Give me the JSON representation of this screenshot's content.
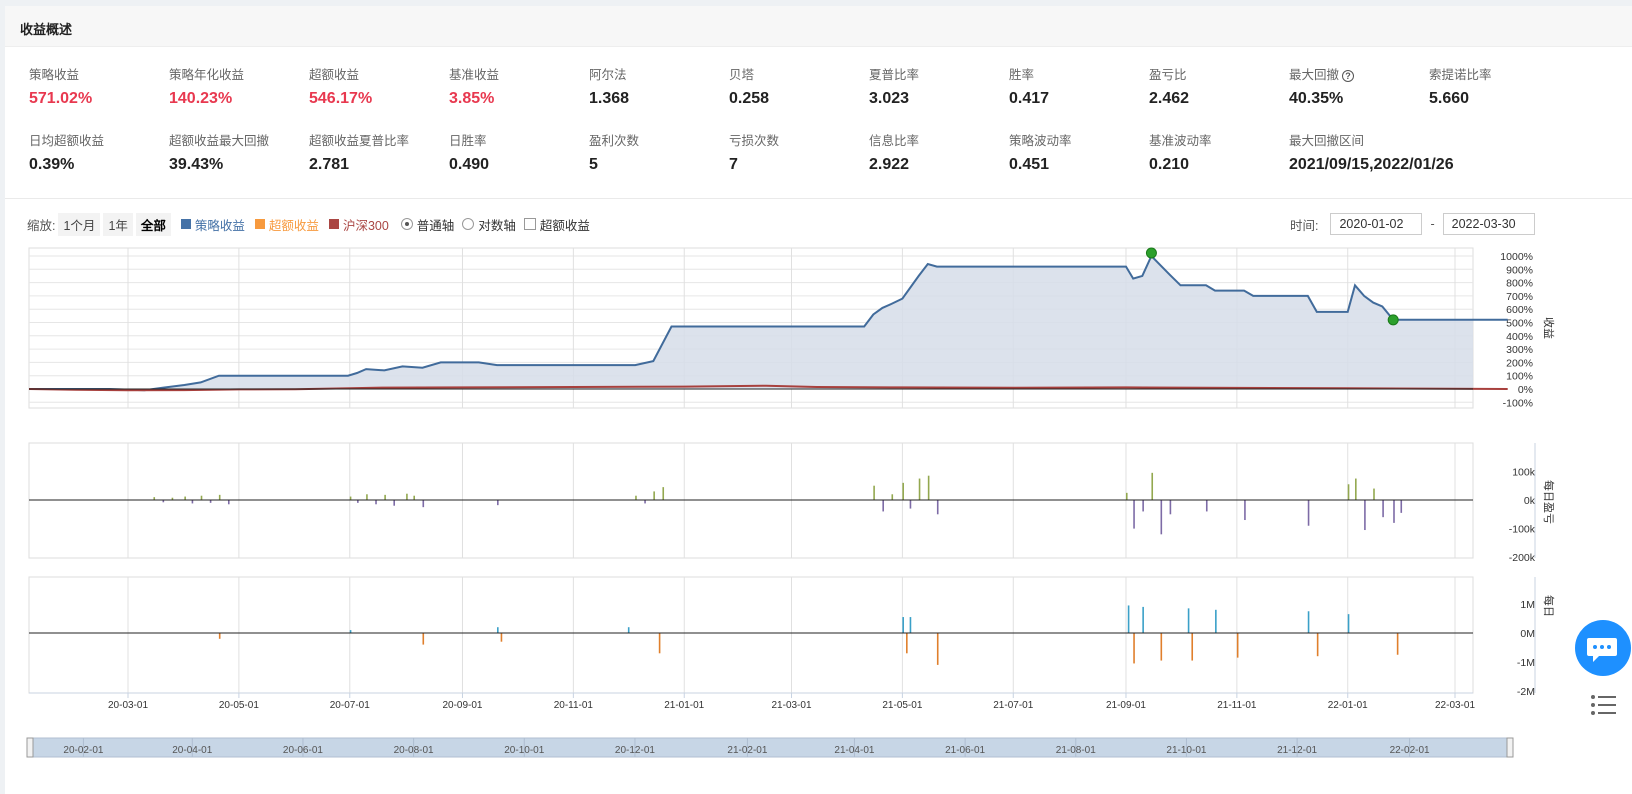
{
  "header": {
    "title": "收益概述"
  },
  "metrics_row1": [
    {
      "label": "策略收益",
      "value": "571.02%",
      "red": true
    },
    {
      "label": "策略年化收益",
      "value": "140.23%",
      "red": true
    },
    {
      "label": "超额收益",
      "value": "546.17%",
      "red": true
    },
    {
      "label": "基准收益",
      "value": "3.85%",
      "red": true
    },
    {
      "label": "阿尔法",
      "value": "1.368",
      "red": false
    },
    {
      "label": "贝塔",
      "value": "0.258",
      "red": false
    },
    {
      "label": "夏普比率",
      "value": "3.023",
      "red": false
    },
    {
      "label": "胜率",
      "value": "0.417",
      "red": false
    },
    {
      "label": "盈亏比",
      "value": "2.462",
      "red": false
    },
    {
      "label": "最大回撤",
      "value": "40.35%",
      "red": false,
      "help": true
    },
    {
      "label": "索提诺比率",
      "value": "5.660",
      "red": false
    }
  ],
  "metrics_row2": [
    {
      "label": "日均超额收益",
      "value": "0.39%"
    },
    {
      "label": "超额收益最大回撤",
      "value": "39.43%"
    },
    {
      "label": "超额收益夏普比率",
      "value": "2.781"
    },
    {
      "label": "日胜率",
      "value": "0.490"
    },
    {
      "label": "盈利次数",
      "value": "5"
    },
    {
      "label": "亏损次数",
      "value": "7"
    },
    {
      "label": "信息比率",
      "value": "2.922"
    },
    {
      "label": "策略波动率",
      "value": "0.451"
    },
    {
      "label": "基准波动率",
      "value": "0.210"
    },
    {
      "label": "最大回撤区间",
      "value": "2021/09/15,2022/01/26"
    }
  ],
  "toolbar": {
    "zoom_label": "缩放:",
    "zoom_options": [
      "1个月",
      "1年",
      "全部"
    ],
    "legend": [
      {
        "name": "策略收益",
        "color": "#4572a7"
      },
      {
        "name": "超额收益",
        "color": "#f79a3e"
      },
      {
        "name": "沪深300",
        "color": "#aa4643"
      }
    ],
    "axis_normal": "普通轴",
    "axis_log": "对数轴",
    "excess_checkbox": "超额收益",
    "time_label": "时间:",
    "start_date": "2020-01-02",
    "date_sep": "-",
    "end_date": "2022-03-30"
  },
  "colors": {
    "strategy": "#416b9b",
    "strategy_fill": "#d6dde9",
    "benchmark": "#a8403d",
    "profit_bar": "#93a84f",
    "loss_bar": "#7d6ba6",
    "buy_bar": "#3aa0c8",
    "sell_bar": "#e07f2c",
    "marker": "#2ca02c",
    "navigator": "#c7d6e6"
  },
  "chart_data": [
    {
      "type": "area",
      "ylabel": "收益",
      "yticks": [
        "1000%",
        "900%",
        "800%",
        "700%",
        "600%",
        "500%",
        "400%",
        "300%",
        "200%",
        "100%",
        "0%",
        "-100%"
      ],
      "ylim": [
        -100,
        1000
      ],
      "x_ticks": [
        "20-03-01",
        "20-05-01",
        "20-07-01",
        "20-09-01",
        "20-11-01",
        "21-01-01",
        "21-03-01",
        "21-05-01",
        "21-07-01",
        "21-09-01",
        "21-11-01",
        "22-01-01",
        "22-03-01"
      ],
      "series": [
        {
          "name": "策略收益",
          "x": [
            "2020-01-02",
            "2020-02-20",
            "2020-03-10",
            "2020-03-20",
            "2020-04-01",
            "2020-04-10",
            "2020-04-20",
            "2020-06-30",
            "2020-07-05",
            "2020-07-10",
            "2020-07-20",
            "2020-07-30",
            "2020-08-10",
            "2020-08-20",
            "2020-09-10",
            "2020-09-20",
            "2020-12-05",
            "2020-12-15",
            "2020-12-25",
            "2021-04-10",
            "2021-04-15",
            "2021-04-20",
            "2021-04-25",
            "2021-05-01",
            "2021-05-10",
            "2021-05-15",
            "2021-05-20",
            "2021-09-01",
            "2021-09-05",
            "2021-09-10",
            "2021-09-15",
            "2021-09-20",
            "2021-09-25",
            "2021-10-01",
            "2021-10-15",
            "2021-10-20",
            "2021-11-05",
            "2021-11-10",
            "2021-12-10",
            "2021-12-15",
            "2022-01-01",
            "2022-01-05",
            "2022-01-10",
            "2022-01-15",
            "2022-01-20",
            "2022-01-26",
            "2022-01-30",
            "2022-03-30"
          ],
          "values": [
            0,
            0,
            -10,
            10,
            30,
            50,
            100,
            100,
            120,
            150,
            140,
            170,
            160,
            200,
            200,
            180,
            180,
            210,
            470,
            470,
            560,
            610,
            640,
            680,
            850,
            940,
            920,
            920,
            830,
            850,
            1000,
            930,
            860,
            780,
            780,
            740,
            740,
            700,
            700,
            580,
            580,
            780,
            700,
            650,
            620,
            520,
            520,
            520
          ]
        },
        {
          "name": "沪深300",
          "x": [
            "2020-01-02",
            "2020-02-01",
            "2020-03-01",
            "2020-04-01",
            "2020-05-01",
            "2020-06-01",
            "2020-07-01",
            "2020-07-15",
            "2020-09-01",
            "2020-11-01",
            "2021-01-01",
            "2021-02-15",
            "2021-03-15",
            "2021-05-01",
            "2021-07-01",
            "2021-09-01",
            "2021-11-01",
            "2022-01-01",
            "2022-03-30"
          ],
          "values": [
            0,
            -5,
            -10,
            -8,
            -3,
            -2,
            5,
            10,
            12,
            15,
            18,
            25,
            15,
            12,
            10,
            12,
            8,
            5,
            0
          ]
        }
      ],
      "markers": [
        {
          "x": "2021-09-15",
          "y": 1000,
          "label": "max drawdown start"
        },
        {
          "x": "2022-01-26",
          "y": 520,
          "label": "max drawdown end"
        }
      ]
    },
    {
      "type": "bar",
      "ylabel": "每日盈亏",
      "yticks": [
        "100k",
        "0k",
        "-100k",
        "-200k"
      ],
      "ylim": [
        -200,
        100
      ],
      "units": "k",
      "bars": [
        [
          "2020-03-15",
          10
        ],
        [
          "2020-03-20",
          -8
        ],
        [
          "2020-03-25",
          8
        ],
        [
          "2020-04-01",
          12
        ],
        [
          "2020-04-05",
          -12
        ],
        [
          "2020-04-10",
          15
        ],
        [
          "2020-04-15",
          -10
        ],
        [
          "2020-04-20",
          18
        ],
        [
          "2020-04-25",
          -15
        ],
        [
          "2020-07-01",
          12
        ],
        [
          "2020-07-05",
          -10
        ],
        [
          "2020-07-10",
          20
        ],
        [
          "2020-07-15",
          -15
        ],
        [
          "2020-07-20",
          18
        ],
        [
          "2020-07-25",
          -20
        ],
        [
          "2020-08-01",
          22
        ],
        [
          "2020-08-05",
          15
        ],
        [
          "2020-08-10",
          -25
        ],
        [
          "2020-09-20",
          -18
        ],
        [
          "2020-12-05",
          15
        ],
        [
          "2020-12-10",
          -12
        ],
        [
          "2020-12-15",
          30
        ],
        [
          "2020-12-20",
          45
        ],
        [
          "2021-04-15",
          50
        ],
        [
          "2021-04-20",
          -40
        ],
        [
          "2021-04-25",
          20
        ],
        [
          "2021-05-01",
          60
        ],
        [
          "2021-05-05",
          -30
        ],
        [
          "2021-05-10",
          75
        ],
        [
          "2021-05-15",
          85
        ],
        [
          "2021-05-20",
          -50
        ],
        [
          "2021-09-01",
          25
        ],
        [
          "2021-09-05",
          -100
        ],
        [
          "2021-09-10",
          -40
        ],
        [
          "2021-09-15",
          95
        ],
        [
          "2021-09-20",
          -120
        ],
        [
          "2021-09-25",
          -50
        ],
        [
          "2021-10-15",
          -40
        ],
        [
          "2021-11-05",
          -70
        ],
        [
          "2021-12-10",
          -90
        ],
        [
          "2022-01-01",
          55
        ],
        [
          "2022-01-05",
          75
        ],
        [
          "2022-01-10",
          -105
        ],
        [
          "2022-01-15",
          40
        ],
        [
          "2022-01-20",
          -60
        ],
        [
          "2022-01-26",
          -80
        ],
        [
          "2022-01-30",
          -45
        ]
      ]
    },
    {
      "type": "bar",
      "ylabel": "每日",
      "yticks": [
        "1M",
        "0M",
        "-1M",
        "-2M"
      ],
      "ylim": [
        -2,
        1
      ],
      "units": "M",
      "bars": [
        [
          "2020-04-20",
          -0.2
        ],
        [
          "2020-07-01",
          0.1
        ],
        [
          "2020-08-10",
          -0.4
        ],
        [
          "2020-09-20",
          0.2
        ],
        [
          "2020-09-22",
          -0.3
        ],
        [
          "2020-12-01",
          0.2
        ],
        [
          "2020-12-18",
          -0.7
        ],
        [
          "2021-05-01",
          0.55
        ],
        [
          "2021-05-03",
          -0.7
        ],
        [
          "2021-05-05",
          0.55
        ],
        [
          "2021-05-20",
          -1.1
        ],
        [
          "2021-09-02",
          0.95
        ],
        [
          "2021-09-05",
          -1.05
        ],
        [
          "2021-09-10",
          0.9
        ],
        [
          "2021-09-20",
          -0.95
        ],
        [
          "2021-10-05",
          0.85
        ],
        [
          "2021-10-07",
          -0.95
        ],
        [
          "2021-10-20",
          0.8
        ],
        [
          "2021-11-01",
          -0.85
        ],
        [
          "2021-12-10",
          0.75
        ],
        [
          "2021-12-15",
          -0.8
        ],
        [
          "2022-01-01",
          0.65
        ],
        [
          "2022-01-28",
          -0.75
        ]
      ]
    }
  ],
  "navigator": {
    "x_ticks": [
      "20-02-01",
      "20-04-01",
      "20-06-01",
      "20-08-01",
      "20-10-01",
      "20-12-01",
      "21-02-01",
      "21-04-01",
      "21-06-01",
      "21-08-01",
      "21-10-01",
      "21-12-01",
      "22-02-01"
    ]
  }
}
